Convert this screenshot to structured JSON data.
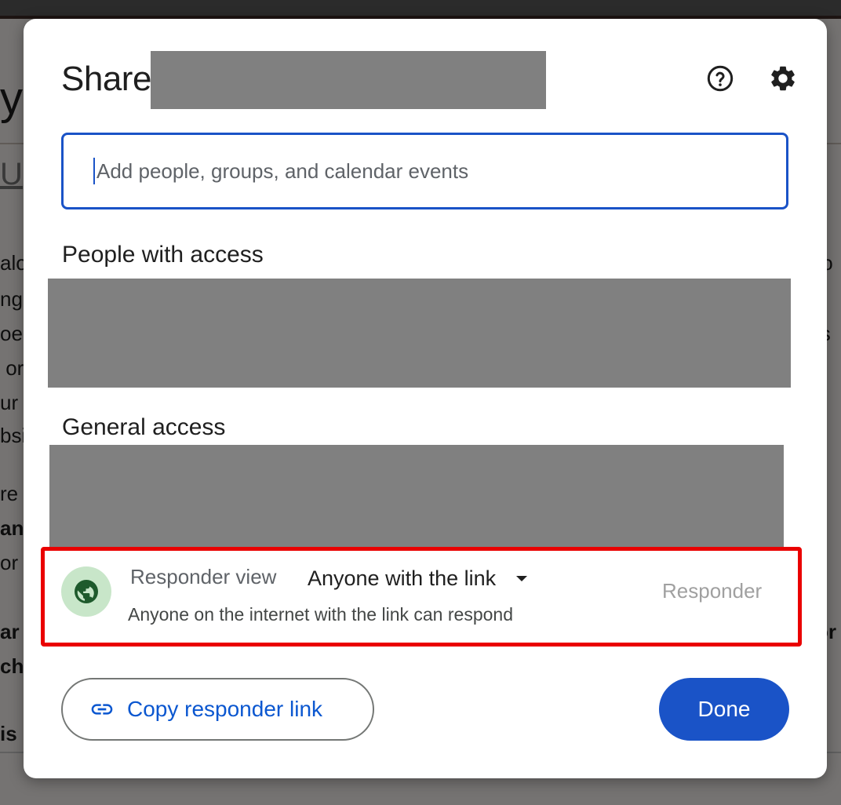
{
  "dialog": {
    "title": "Share",
    "help_icon": "help-circle-icon",
    "settings_icon": "gear-icon"
  },
  "search": {
    "placeholder": "Add people, groups, and calendar events"
  },
  "people_section": {
    "title": "People with access"
  },
  "general_section": {
    "title": "General access",
    "access_label": "Responder view",
    "access_option": "Anyone with the link",
    "access_description": "Anyone on the internet with the link can respond",
    "role": "Responder",
    "icon": "globe-icon"
  },
  "footer": {
    "copy_link_label": "Copy responder link",
    "copy_link_icon": "link-icon",
    "done_label": "Done"
  },
  "colors": {
    "accent": "#1a53c7",
    "highlight_border": "#ea0000",
    "globe_bg": "#c8e6c9",
    "globe_fg": "#1e5a2c"
  }
}
